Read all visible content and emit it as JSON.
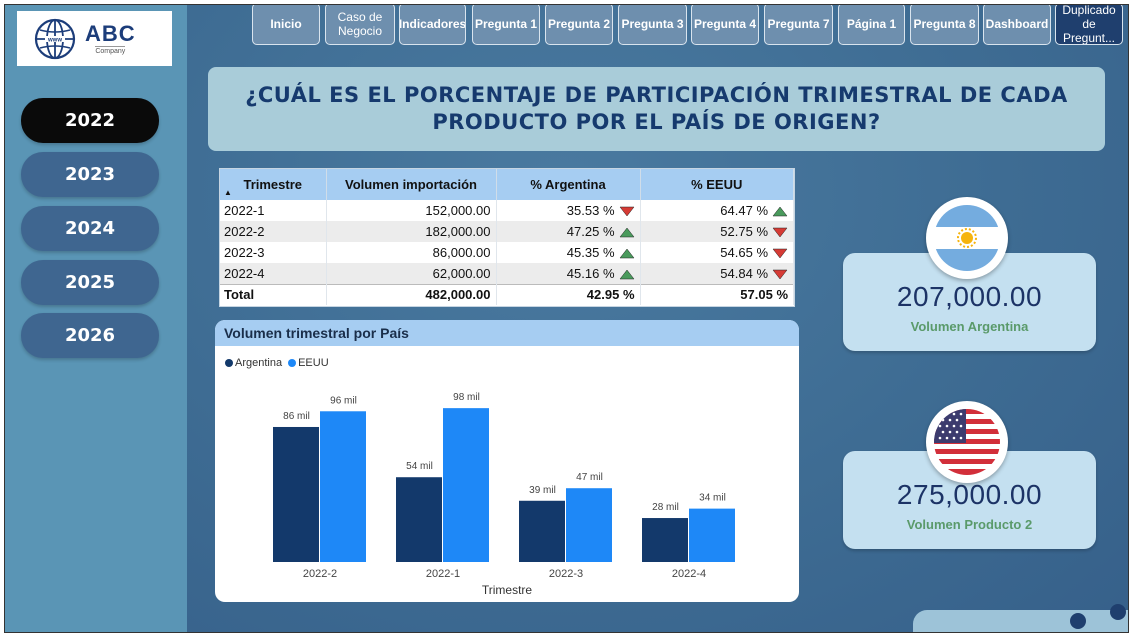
{
  "logo": {
    "brand": "ABC",
    "subtitle": "Company"
  },
  "sidebar": {
    "years": [
      {
        "label": "2022",
        "active": true
      },
      {
        "label": "2023",
        "active": false
      },
      {
        "label": "2024",
        "active": false
      },
      {
        "label": "2025",
        "active": false
      },
      {
        "label": "2026",
        "active": false
      }
    ]
  },
  "nav": {
    "buttons": [
      {
        "label": "Inicio"
      },
      {
        "label": "Caso de Negocio"
      },
      {
        "label": "Indicadores"
      },
      {
        "label": "Pregunta 1"
      },
      {
        "label": "Pregunta 2"
      },
      {
        "label": "Pregunta 3"
      },
      {
        "label": "Pregunta 4"
      },
      {
        "label": "Pregunta 7"
      },
      {
        "label": "Página 1"
      },
      {
        "label": "Pregunta 8"
      },
      {
        "label": "Dashboard"
      },
      {
        "label": "Duplicado de Pregunt..."
      }
    ]
  },
  "question": "¿CUÁL ES EL PORCENTAJE DE PARTICIPACIÓN TRIMESTRAL DE CADA PRODUCTO POR EL PAÍS DE ORIGEN?",
  "table": {
    "columns": [
      "Trimestre",
      "Volumen importación",
      "% Argentina",
      "% EEUU"
    ],
    "rows": [
      {
        "trimestre": "2022-1",
        "volumen": "152,000.00",
        "argentina": "35.53 %",
        "arg_trend": "down",
        "eeuu": "64.47 %",
        "eeuu_trend": "up"
      },
      {
        "trimestre": "2022-2",
        "volumen": "182,000.00",
        "argentina": "47.25 %",
        "arg_trend": "up",
        "eeuu": "52.75 %",
        "eeuu_trend": "down"
      },
      {
        "trimestre": "2022-3",
        "volumen": "86,000.00",
        "argentina": "45.35 %",
        "arg_trend": "up",
        "eeuu": "54.65 %",
        "eeuu_trend": "down"
      },
      {
        "trimestre": "2022-4",
        "volumen": "62,000.00",
        "argentina": "45.16 %",
        "arg_trend": "up",
        "eeuu": "54.84 %",
        "eeuu_trend": "down"
      }
    ],
    "total": {
      "label": "Total",
      "volumen": "482,000.00",
      "argentina": "42.95 %",
      "eeuu": "57.05 %"
    }
  },
  "colors": {
    "argentina": "#13396b",
    "eeuu": "#1e88f7",
    "trend_up": "#4a9a5c",
    "trend_down": "#d63b35"
  },
  "chart_data": {
    "type": "bar",
    "title": "Volumen trimestral por País",
    "xlabel": "Trimestre",
    "ylabel": "",
    "categories": [
      "2022-2",
      "2022-1",
      "2022-3",
      "2022-4"
    ],
    "series": [
      {
        "name": "Argentina",
        "values": [
          86,
          54,
          39,
          28
        ],
        "labels": [
          "86 mil",
          "54 mil",
          "39 mil",
          "28 mil"
        ]
      },
      {
        "name": "EEUU",
        "values": [
          96,
          98,
          47,
          34
        ],
        "labels": [
          "96 mil",
          "98 mil",
          "47 mil",
          "34 mil"
        ]
      }
    ],
    "ylim": [
      0,
      100
    ],
    "grid": false,
    "legend": "top-left"
  },
  "kpis": [
    {
      "value": "207,000.00",
      "label": "Volumen Argentina",
      "flag": "argentina-flag"
    },
    {
      "value": "275,000.00",
      "label": "Volumen Producto 2",
      "flag": "usa-flag"
    }
  ]
}
